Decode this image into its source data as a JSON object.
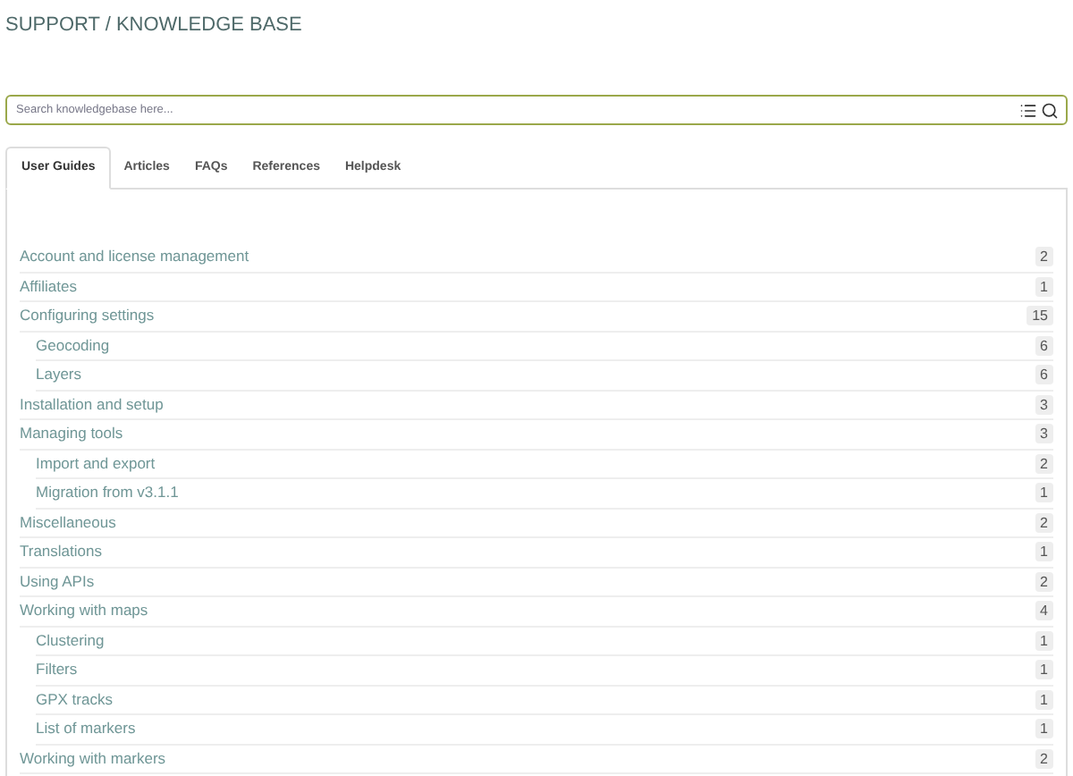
{
  "title": "SUPPORT / KNOWLEDGE BASE",
  "search": {
    "placeholder": "Search knowledgebase here..."
  },
  "tabs": [
    {
      "label": "User Guides",
      "selected": true
    },
    {
      "label": "Articles",
      "selected": false
    },
    {
      "label": "FAQs",
      "selected": false
    },
    {
      "label": "References",
      "selected": false
    },
    {
      "label": "Helpdesk",
      "selected": false
    }
  ],
  "categories": [
    {
      "label": "Account and license management",
      "count": "2"
    },
    {
      "label": "Affiliates",
      "count": "1"
    },
    {
      "label": "Configuring settings",
      "count": "15",
      "children": [
        {
          "label": "Geocoding",
          "count": "6"
        },
        {
          "label": "Layers",
          "count": "6"
        }
      ]
    },
    {
      "label": "Installation and setup",
      "count": "3"
    },
    {
      "label": "Managing tools",
      "count": "3",
      "children": [
        {
          "label": "Import and export",
          "count": "2"
        },
        {
          "label": "Migration from v3.1.1",
          "count": "1"
        }
      ]
    },
    {
      "label": "Miscellaneous",
      "count": "2"
    },
    {
      "label": "Translations",
      "count": "1"
    },
    {
      "label": "Using APIs",
      "count": "2"
    },
    {
      "label": "Working with maps",
      "count": "4",
      "children": [
        {
          "label": "Clustering",
          "count": "1"
        },
        {
          "label": "Filters",
          "count": "1"
        },
        {
          "label": "GPX tracks",
          "count": "1"
        },
        {
          "label": "List of markers",
          "count": "1"
        }
      ]
    },
    {
      "label": "Working with markers",
      "count": "2"
    }
  ]
}
